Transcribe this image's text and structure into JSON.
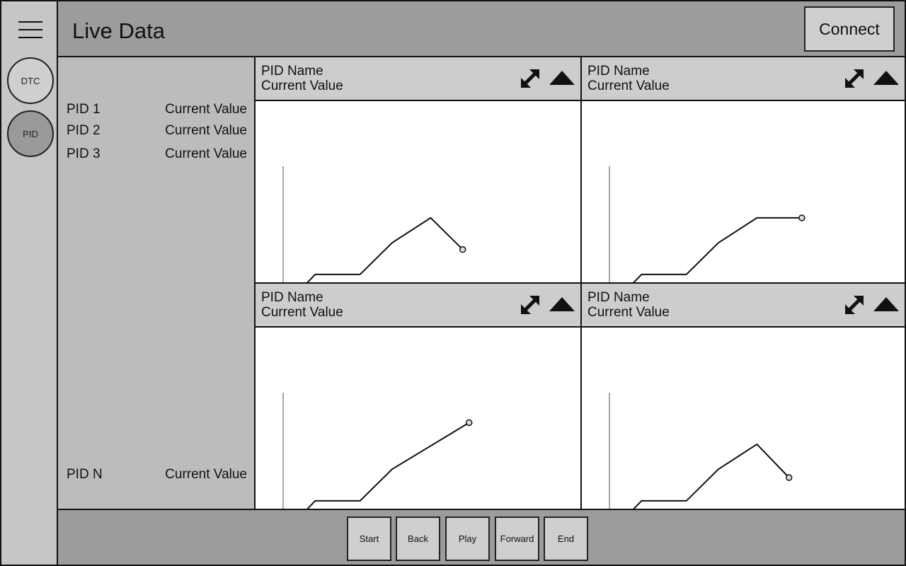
{
  "nav": {
    "menu_icon": "hamburger-menu-icon",
    "items": [
      {
        "label": "DTC",
        "active": false
      },
      {
        "label": "PID",
        "active": true
      }
    ]
  },
  "header": {
    "title": "Live Data",
    "connect_label": "Connect"
  },
  "pid_list": [
    {
      "name": "PID 1",
      "value": "Current Value"
    },
    {
      "name": "PID 2",
      "value": "Current Value"
    },
    {
      "name": "PID 3",
      "value": "Current Value"
    },
    {
      "name": "PID N",
      "value": "Current Value"
    }
  ],
  "panels": [
    {
      "name": "PID Name",
      "value": "Current Value",
      "icons": [
        "expand-icon",
        "collapse-triangle-icon"
      ]
    },
    {
      "name": "PID Name",
      "value": "Current Value",
      "icons": [
        "expand-icon",
        "collapse-triangle-icon"
      ]
    },
    {
      "name": "PID Name",
      "value": "Current Value",
      "icons": [
        "expand-icon",
        "collapse-triangle-icon"
      ]
    },
    {
      "name": "PID Name",
      "value": "Current Value",
      "icons": [
        "expand-icon",
        "collapse-triangle-icon"
      ]
    }
  ],
  "chart_data": [
    {
      "type": "line",
      "x": [
        0,
        1,
        2.4,
        3.4,
        4.6,
        5.6
      ],
      "values": [
        0,
        2.0,
        2.0,
        3.9,
        5.4,
        3.5
      ],
      "xlim": [
        0,
        8.3
      ],
      "ylim": [
        0,
        8.5
      ]
    },
    {
      "type": "line",
      "x": [
        0,
        1,
        2.4,
        3.4,
        4.6,
        6.0
      ],
      "values": [
        0,
        2.0,
        2.0,
        3.9,
        5.4,
        5.4
      ],
      "xlim": [
        0,
        8.3
      ],
      "ylim": [
        0,
        8.5
      ]
    },
    {
      "type": "line",
      "x": [
        0,
        1,
        2.4,
        3.4,
        5.8
      ],
      "values": [
        0,
        2.0,
        2.0,
        3.9,
        6.7
      ],
      "xlim": [
        0,
        8.3
      ],
      "ylim": [
        0,
        8.5
      ]
    },
    {
      "type": "line",
      "x": [
        0,
        1,
        2.4,
        3.4,
        4.6,
        5.6
      ],
      "values": [
        0,
        2.0,
        2.0,
        3.9,
        5.4,
        3.4
      ],
      "xlim": [
        0,
        8.3
      ],
      "ylim": [
        0,
        8.5
      ]
    }
  ],
  "controls": [
    "Start",
    "Back",
    "Play",
    "Forward",
    "End"
  ]
}
